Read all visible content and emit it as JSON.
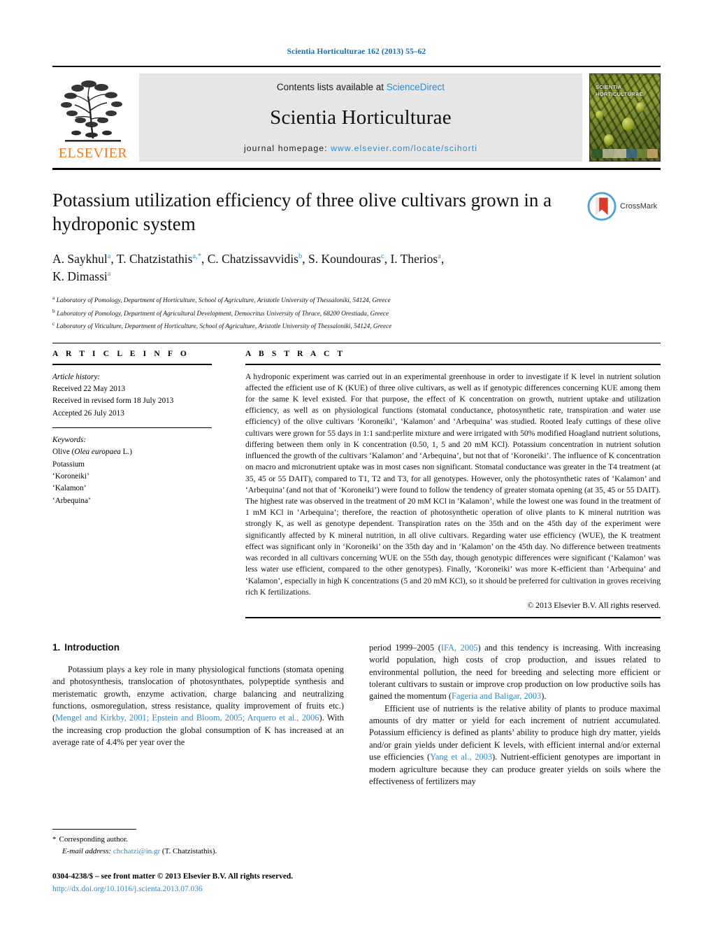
{
  "running_head": "Scientia Horticulturae 162 (2013) 55–62",
  "masthead": {
    "publisher_name": "ELSEVIER",
    "publisher_logo_name": "elsevier-tree-logo",
    "contents_prefix": "Contents lists available at",
    "contents_link": "ScienceDirect",
    "journal_title": "Scientia Horticulturae",
    "homepage_prefix": "journal homepage:",
    "homepage_url": "www.elsevier.com/locate/scihorti",
    "cover_title": "SCIENTIA HORTICULTURAE",
    "colors": {
      "link": "#2e8bc9",
      "elsevier_orange": "#F47920",
      "band_bg": "#e6e6e6"
    }
  },
  "article": {
    "title": "Potassium utilization efficiency of three olive cultivars grown in a hydroponic system",
    "crossmark_label": "CrossMark",
    "authors": "A. Saykhul a, T. Chatzistathis a,*, C. Chatzissavvidis b, S. Koundouras c, I. Therios a, K. Dimassi a",
    "author_list": [
      {
        "name": "A. Saykhul",
        "marks": "a"
      },
      {
        "name": "T. Chatzistathis",
        "marks": "a,*"
      },
      {
        "name": "C. Chatzissavvidis",
        "marks": "b"
      },
      {
        "name": "S. Koundouras",
        "marks": "c"
      },
      {
        "name": "I. Therios",
        "marks": "a"
      },
      {
        "name": "K. Dimassi",
        "marks": "a"
      }
    ],
    "affiliations": [
      {
        "mark": "a",
        "text": "Laboratory of Pomology, Department of Horticulture, School of Agriculture, Aristotle University of Thessaloniki, 54124, Greece"
      },
      {
        "mark": "b",
        "text": "Laboratory of Pomology, Department of Agricultural Development, Democritus University of Thrace, 68200 Orestiada, Greece"
      },
      {
        "mark": "c",
        "text": "Laboratory of Viticulture, Department of Horticulture, School of Agriculture, Aristotle University of Thessaloniki, 54124, Greece"
      }
    ]
  },
  "article_info": {
    "heading": "A R T I C L E    I N F O",
    "history_label": "Article history:",
    "history": [
      "Received 22 May 2013",
      "Received in revised form 18 July 2013",
      "Accepted 26 July 2013"
    ],
    "keywords_label": "Keywords:",
    "keywords": [
      "Olive (Olea europaea L.)",
      "Potassium",
      "‘Koroneiki’",
      "‘Kalamon’",
      "‘Arbequina’"
    ],
    "keyword_italic_part": "Olea europaea"
  },
  "abstract": {
    "heading": "A B S T R A C T",
    "text": "A hydroponic experiment was carried out in an experimental greenhouse in order to investigate if K level in nutrient solution affected the efficient use of K (KUE) of three olive cultivars, as well as if genotypic differences concerning KUE among them for the same K level existed. For that purpose, the effect of K concentration on growth, nutrient uptake and utilization efficiency, as well as on physiological functions (stomatal conductance, photosynthetic rate, transpiration and water use efficiency) of the olive cultivars ‘Koroneiki’, ‘Kalamon’ and ‘Arbequina’ was studied. Rooted leafy cuttings of these olive cultivars were grown for 55 days in 1:1 sand:perlite mixture and were irrigated with 50% modified Hoagland nutrient solutions, differing between them only in K concentration (0.50, 1, 5 and 20 mM KCl). Potassium concentration in nutrient solution influenced the growth of the cultivars ‘Kalamon’ and ‘Arbequina’, but not that of ‘Koroneiki’. The influence of K concentration on macro and micronutrient uptake was in most cases non significant. Stomatal conductance was greater in the T4 treatment (at 35, 45 or 55 DAIT), compared to T1, T2 and T3, for all genotypes. However, only the photosynthetic rates of ‘Kalamon’ and ‘Arbequina’ (and not that of ‘Koroneiki’) were found to follow the tendency of greater stomata opening (at 35, 45 or 55 DAIT). The highest rate was observed in the treatment of 20 mM KCl in ‘Kalamon’, while the lowest one was found in the treatment of 1 mM KCl in ‘Arbequina’; therefore, the reaction of photosynthetic operation of olive plants to K mineral nutrition was strongly K, as well as genotype dependent. Transpiration rates on the 35th and on the 45th day of the experiment were significantly affected by K mineral nutrition, in all olive cultivars. Regarding water use efficiency (WUE), the K treatment effect was significant only in ‘Koroneiki’ on the 35th day and in ‘Kalamon’ on the 45th day. No difference between treatments was recorded in all cultivars concerning WUE on the 55th day, though genotypic differences were significant (‘Kalamon’ was less water use efficient, compared to the other genotypes). Finally, ‘Koroneiki’ was more K-efficient than ‘Arbequina’ and ‘Kalamon’, especially in high K concentrations (5 and 20 mM KCl), so it should be preferred for cultivation in groves receiving rich K fertilizations.",
    "copyright": "© 2013 Elsevier B.V. All rights reserved."
  },
  "introduction": {
    "number": "1.",
    "title": "Introduction",
    "left_para_1_a": "Potassium plays a key role in many physiological functions (stomata opening and photosynthesis, translocation of photosynthates, polypeptide synthesis and meristematic growth, enzyme activation, charge balancing and neutralizing functions, osmoregulation, stress resistance, quality improvement of fruits etc.)(",
    "left_ref_1": "Mengel and Kirkby, 2001; Epstein and Bloom, 2005; Arquero et al., 2006",
    "left_para_1_b": "). With the increasing crop production the global consumption of K has increased at an average rate of 4.4% per year over the",
    "right_para_1_a": "period 1999–2005 (",
    "right_ref_1": "IFA, 2005",
    "right_para_1_b": ") and this tendency is increasing. With increasing world population, high costs of crop production, and issues related to environmental pollution, the need for breeding and selecting more efficient or tolerant cultivars to sustain or improve crop production on low productive soils has gained the momentum (",
    "right_ref_2": "Fageria and Baligar, 2003",
    "right_para_1_c": ").",
    "right_para_2_a": "Efficient use of nutrients is the relative ability of plants to produce maximal amounts of dry matter or yield for each increment of nutrient accumulated. Potassium efficiency is defined as plants’ ability to produce high dry matter, yields and/or grain yields under deficient K levels, with efficient internal and/or external use efficiencies (",
    "right_ref_3": "Yang et al., 2003",
    "right_para_2_b": "). Nutrient-efficient genotypes are important in modern agriculture because they can produce greater yields on soils where the effectiveness of fertilizers may"
  },
  "footnotes": {
    "corresponding_star": "*",
    "corresponding_text": "Corresponding author.",
    "email_label": "E-mail address:",
    "email": "chchatzi@in.gr",
    "email_owner": "(T. Chatzistathis)."
  },
  "footer": {
    "issn_line": "0304-4238/$ – see front matter © 2013 Elsevier B.V. All rights reserved.",
    "doi": "http://dx.doi.org/10.1016/j.scienta.2013.07.036"
  }
}
